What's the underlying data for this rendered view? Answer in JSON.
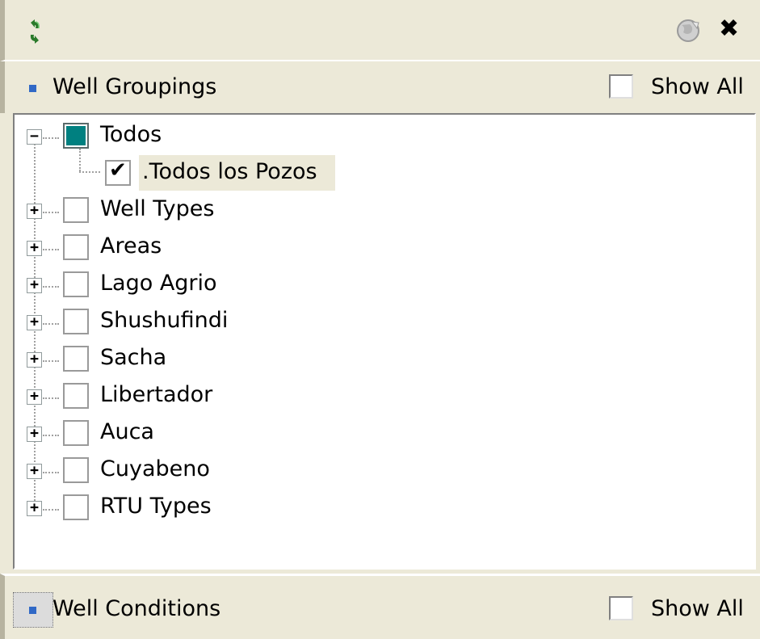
{
  "toolbar": {
    "refresh_icon": "refresh-icon",
    "globe_icon": "globe-icon",
    "close_icon": "close-icon",
    "close_glyph": "✖"
  },
  "well_groupings": {
    "title": "Well Groupings",
    "show_all_label": "Show All",
    "show_all_checked": false
  },
  "tree": {
    "items": [
      {
        "label": "Todos",
        "expanded": true,
        "state": "partial",
        "accent": "#008080",
        "children": [
          {
            "label": ".Todos los Pozos",
            "checked": true,
            "selected": true
          }
        ]
      },
      {
        "label": "Well Types",
        "expanded": false,
        "checked": false
      },
      {
        "label": "Areas",
        "expanded": false,
        "checked": false
      },
      {
        "label": "Lago Agrio",
        "expanded": false,
        "checked": false
      },
      {
        "label": "Shushufindi",
        "expanded": false,
        "checked": false
      },
      {
        "label": "Sacha",
        "expanded": false,
        "checked": false
      },
      {
        "label": "Libertador",
        "expanded": false,
        "checked": false
      },
      {
        "label": "Auca",
        "expanded": false,
        "checked": false
      },
      {
        "label": "Cuyabeno",
        "expanded": false,
        "checked": false
      },
      {
        "label": "RTU Types",
        "expanded": false,
        "checked": false
      }
    ],
    "expand_glyph": "+",
    "collapse_glyph": "−",
    "check_glyph": "✔"
  },
  "well_conditions": {
    "title": "Well Conditions",
    "show_all_label": "Show All",
    "show_all_checked": false
  },
  "colors": {
    "panel": "#ece9d8",
    "bullet": "#3169c6",
    "partial_fill": "#008080",
    "selection": "#ece9d8"
  }
}
